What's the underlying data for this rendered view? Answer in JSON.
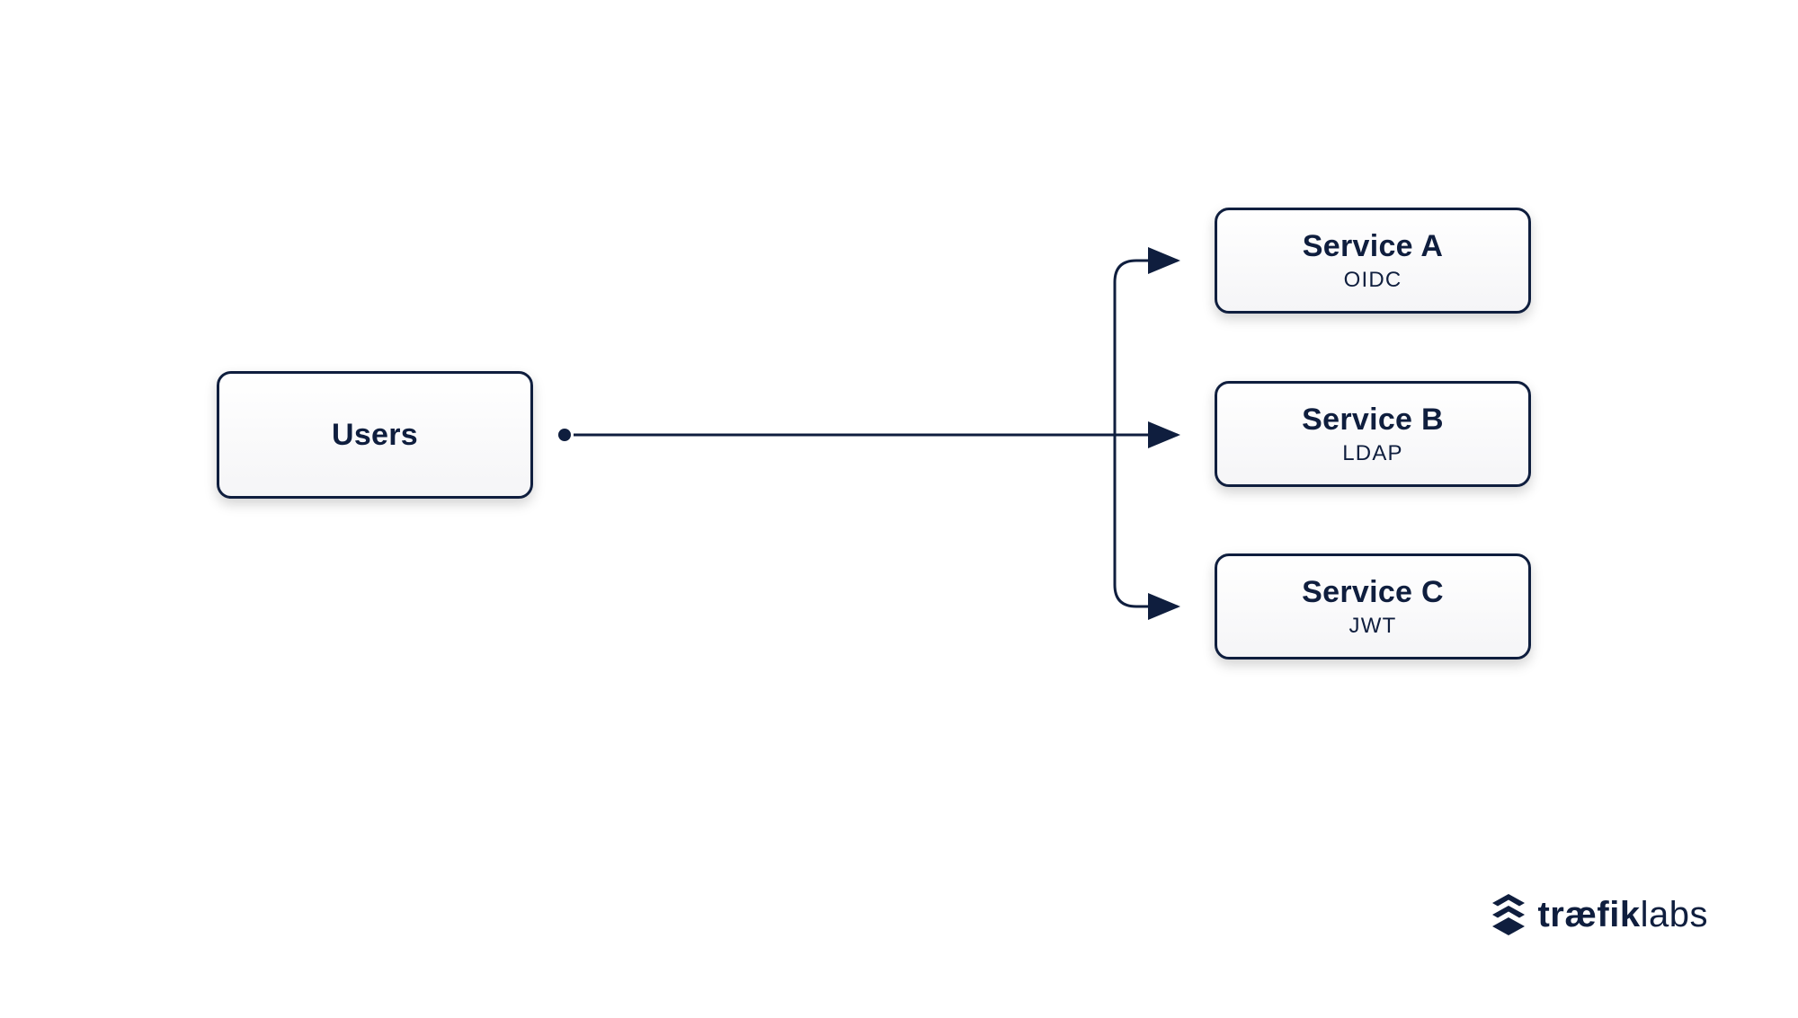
{
  "diagram": {
    "source": {
      "label": "Users"
    },
    "services": [
      {
        "name": "Service A",
        "auth": "OIDC"
      },
      {
        "name": "Service B",
        "auth": "LDAP"
      },
      {
        "name": "Service C",
        "auth": "JWT"
      }
    ]
  },
  "brand": {
    "name_prefix": "træfik",
    "name_suffix": "labs"
  },
  "colors": {
    "text": "#0f1e3e",
    "box_border": "#0f1e3e",
    "box_bg_top": "#ffffff",
    "box_bg_bottom": "#f5f5f7"
  }
}
